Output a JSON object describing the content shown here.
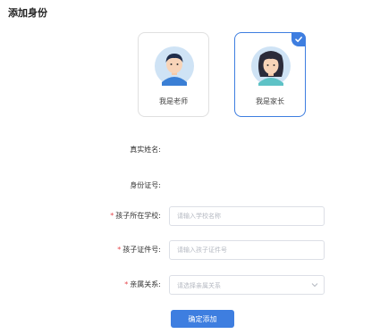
{
  "page": {
    "title": "添加身份"
  },
  "identity_cards": [
    {
      "label": "我是老师",
      "selected": false,
      "icon": "teacher-avatar-icon"
    },
    {
      "label": "我是家长",
      "selected": true,
      "icon": "parent-avatar-icon"
    }
  ],
  "form": {
    "real_name": {
      "label": "真实姓名:",
      "value": ""
    },
    "id_number": {
      "label": "身份证号:",
      "value": ""
    },
    "school": {
      "required_mark": "*",
      "label": "孩子所在学校:",
      "placeholder": "请输入学校名称",
      "value": ""
    },
    "child_id": {
      "required_mark": "*",
      "label": "孩子证件号:",
      "placeholder": "请输入孩子证件号",
      "value": ""
    },
    "relation": {
      "required_mark": "*",
      "label": "亲属关系:",
      "placeholder": "请选择亲属关系",
      "value": ""
    },
    "submit_label": "确定添加"
  },
  "colors": {
    "accent": "#3e7ee0",
    "required": "#e5484d",
    "avatar_bg": "#cfe3f5"
  }
}
